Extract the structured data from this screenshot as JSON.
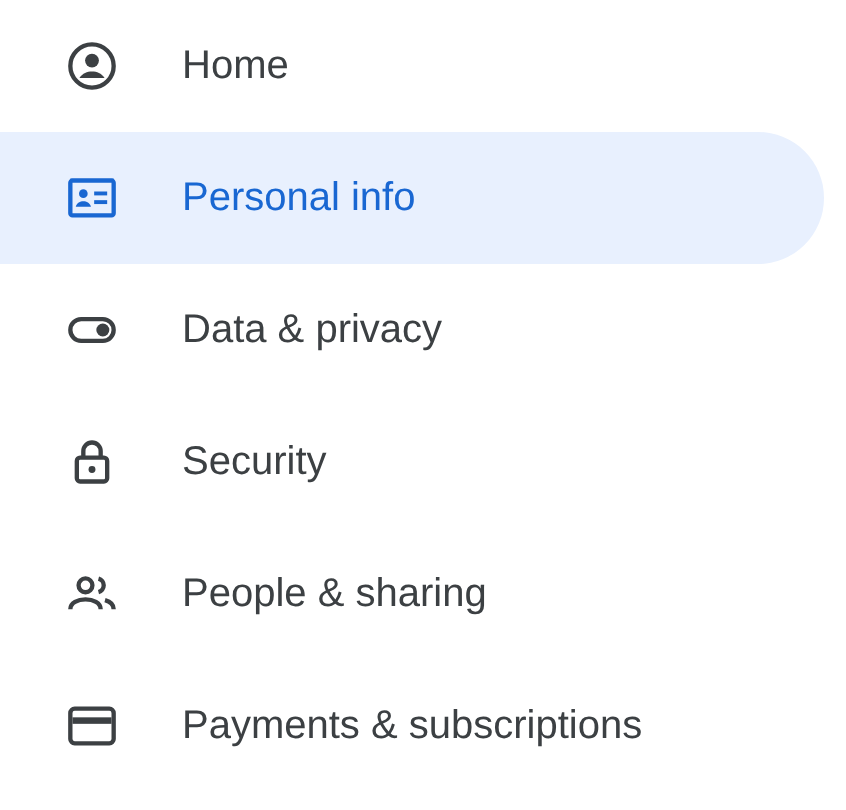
{
  "nav_items": [
    {
      "label": "Home",
      "selected": false
    },
    {
      "label": "Personal info",
      "selected": true
    },
    {
      "label": "Data & privacy",
      "selected": false
    },
    {
      "label": "Security",
      "selected": false
    },
    {
      "label": "People & sharing",
      "selected": false
    },
    {
      "label": "Payments & subscriptions",
      "selected": false
    }
  ]
}
